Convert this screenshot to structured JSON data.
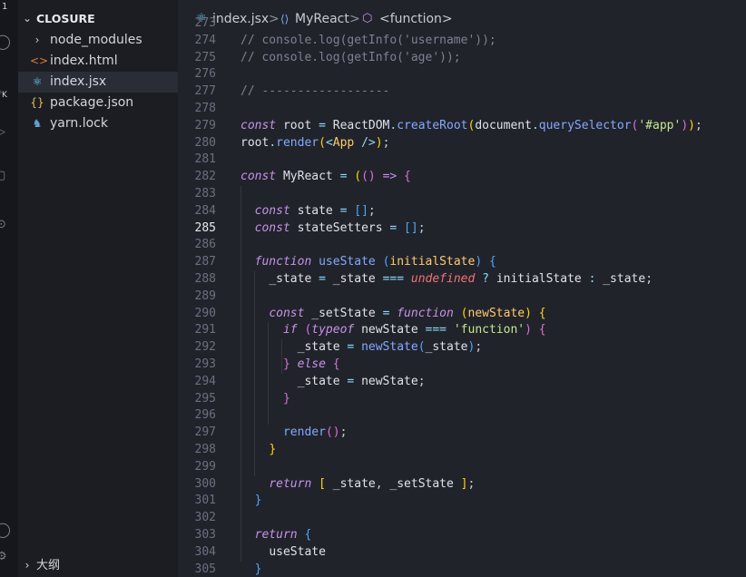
{
  "activity_bar": {
    "top_label": "1",
    "side_label": "K",
    "icons": [
      "account-icon",
      "search-icon",
      "source-control-icon",
      "run-debug-icon",
      "extensions-icon",
      "remote-icon",
      "settings-icon"
    ]
  },
  "explorer": {
    "folder": "CLOSURE",
    "items": [
      {
        "name": "node_modules",
        "icon": "chevron-right-icon",
        "glyph": "›",
        "color": "#c9ccd6"
      },
      {
        "name": "index.html",
        "icon": "html-file-icon",
        "glyph": "<>",
        "color": "#e37933"
      },
      {
        "name": "index.jsx",
        "icon": "react-file-icon",
        "glyph": "⚛",
        "color": "#61dafb"
      },
      {
        "name": "package.json",
        "icon": "json-file-icon",
        "glyph": "{}",
        "color": "#e2c04d"
      },
      {
        "name": "yarn.lock",
        "icon": "yarn-file-icon",
        "glyph": "♞",
        "color": "#5ea8d8"
      }
    ],
    "outline_label": "大纲"
  },
  "breadcrumb": {
    "file": "index.jsx",
    "symbol": "MyReact",
    "function": "<function>",
    "separator": ">"
  },
  "editor": {
    "current_line": 285,
    "lines": [
      {
        "n": 273,
        "t": []
      },
      {
        "n": 274,
        "t": [
          [
            "c-com",
            "// console.log(getInfo('username'));"
          ]
        ]
      },
      {
        "n": 275,
        "t": [
          [
            "c-com",
            "// console.log(getInfo('age'));"
          ]
        ]
      },
      {
        "n": 276,
        "t": []
      },
      {
        "n": 277,
        "t": [
          [
            "c-com",
            "// ------------------"
          ]
        ]
      },
      {
        "n": 278,
        "t": []
      },
      {
        "n": 279,
        "t": [
          [
            "c-kw",
            "const"
          ],
          [
            "c-p",
            " "
          ],
          [
            "c-id",
            "root"
          ],
          [
            "c-p",
            " "
          ],
          [
            "c-op",
            "="
          ],
          [
            "c-p",
            " "
          ],
          [
            "c-id",
            "ReactDOM"
          ],
          [
            "c-op",
            "."
          ],
          [
            "c-fn",
            "createRoot"
          ],
          [
            "c-br",
            "("
          ],
          [
            "c-id",
            "document"
          ],
          [
            "c-op",
            "."
          ],
          [
            "c-fn",
            "querySelector"
          ],
          [
            "c-br2",
            "("
          ],
          [
            "c-str",
            "'#app'"
          ],
          [
            "c-br2",
            ")"
          ],
          [
            "c-br",
            ")"
          ],
          [
            "c-p",
            ";"
          ]
        ]
      },
      {
        "n": 280,
        "t": [
          [
            "c-id",
            "root"
          ],
          [
            "c-op",
            "."
          ],
          [
            "c-fn",
            "render"
          ],
          [
            "c-br",
            "("
          ],
          [
            "c-tag",
            "<"
          ],
          [
            "c-cls",
            "App"
          ],
          [
            "c-p",
            " "
          ],
          [
            "c-tag",
            "/>"
          ],
          [
            "c-br",
            ")"
          ],
          [
            "c-p",
            ";"
          ]
        ]
      },
      {
        "n": 281,
        "t": []
      },
      {
        "n": 282,
        "t": [
          [
            "c-kw",
            "const"
          ],
          [
            "c-p",
            " "
          ],
          [
            "c-id",
            "MyReact"
          ],
          [
            "c-p",
            " "
          ],
          [
            "c-op",
            "="
          ],
          [
            "c-p",
            " "
          ],
          [
            "c-br",
            "("
          ],
          [
            "c-br2",
            "("
          ],
          [
            "c-br2",
            ")"
          ],
          [
            "c-p",
            " "
          ],
          [
            "c-kw",
            "=>"
          ],
          [
            "c-p",
            " "
          ],
          [
            "c-br2",
            "{"
          ]
        ]
      },
      {
        "n": 283,
        "t": []
      },
      {
        "n": 284,
        "t": [
          [
            "c-p",
            "  "
          ],
          [
            "c-kw",
            "const"
          ],
          [
            "c-p",
            " "
          ],
          [
            "c-id",
            "state"
          ],
          [
            "c-p",
            " "
          ],
          [
            "c-op",
            "="
          ],
          [
            "c-p",
            " "
          ],
          [
            "c-br3",
            "[]"
          ],
          [
            "c-p",
            ";"
          ]
        ]
      },
      {
        "n": 285,
        "t": [
          [
            "c-p",
            "  "
          ],
          [
            "c-kw",
            "const"
          ],
          [
            "c-p",
            " "
          ],
          [
            "c-id",
            "stateSetters"
          ],
          [
            "c-p",
            " "
          ],
          [
            "c-op",
            "="
          ],
          [
            "c-p",
            " "
          ],
          [
            "c-br3",
            "[]"
          ],
          [
            "c-p",
            ";"
          ]
        ]
      },
      {
        "n": 286,
        "t": []
      },
      {
        "n": 287,
        "t": [
          [
            "c-p",
            "  "
          ],
          [
            "c-kw",
            "function"
          ],
          [
            "c-p",
            " "
          ],
          [
            "c-fn",
            "useState"
          ],
          [
            "c-p",
            " "
          ],
          [
            "c-br3",
            "("
          ],
          [
            "c-prm",
            "initialState"
          ],
          [
            "c-br3",
            ")"
          ],
          [
            "c-p",
            " "
          ],
          [
            "c-br3",
            "{"
          ]
        ]
      },
      {
        "n": 288,
        "t": [
          [
            "c-p",
            "    "
          ],
          [
            "c-id",
            "_state"
          ],
          [
            "c-p",
            " "
          ],
          [
            "c-op",
            "="
          ],
          [
            "c-p",
            " "
          ],
          [
            "c-id",
            "_state"
          ],
          [
            "c-p",
            " "
          ],
          [
            "c-op",
            "==="
          ],
          [
            "c-p",
            " "
          ],
          [
            "c-und",
            "undefined"
          ],
          [
            "c-p",
            " "
          ],
          [
            "c-op",
            "?"
          ],
          [
            "c-p",
            " "
          ],
          [
            "c-id",
            "initialState"
          ],
          [
            "c-p",
            " "
          ],
          [
            "c-op",
            ":"
          ],
          [
            "c-p",
            " "
          ],
          [
            "c-id",
            "_state"
          ],
          [
            "c-p",
            ";"
          ]
        ]
      },
      {
        "n": 289,
        "t": []
      },
      {
        "n": 290,
        "t": [
          [
            "c-p",
            "    "
          ],
          [
            "c-kw",
            "const"
          ],
          [
            "c-p",
            " "
          ],
          [
            "c-id",
            "_setState"
          ],
          [
            "c-p",
            " "
          ],
          [
            "c-op",
            "="
          ],
          [
            "c-p",
            " "
          ],
          [
            "c-kw",
            "function"
          ],
          [
            "c-p",
            " "
          ],
          [
            "c-br",
            "("
          ],
          [
            "c-prm",
            "newState"
          ],
          [
            "c-br",
            ")"
          ],
          [
            "c-p",
            " "
          ],
          [
            "c-br",
            "{"
          ]
        ]
      },
      {
        "n": 291,
        "t": [
          [
            "c-p",
            "      "
          ],
          [
            "c-kw",
            "if"
          ],
          [
            "c-p",
            " "
          ],
          [
            "c-br2",
            "("
          ],
          [
            "c-kw",
            "typeof"
          ],
          [
            "c-p",
            " "
          ],
          [
            "c-id",
            "newState"
          ],
          [
            "c-p",
            " "
          ],
          [
            "c-op",
            "==="
          ],
          [
            "c-p",
            " "
          ],
          [
            "c-str",
            "'function'"
          ],
          [
            "c-br2",
            ")"
          ],
          [
            "c-p",
            " "
          ],
          [
            "c-br2",
            "{"
          ]
        ]
      },
      {
        "n": 292,
        "t": [
          [
            "c-p",
            "        "
          ],
          [
            "c-id",
            "_state"
          ],
          [
            "c-p",
            " "
          ],
          [
            "c-op",
            "="
          ],
          [
            "c-p",
            " "
          ],
          [
            "c-fn",
            "newState"
          ],
          [
            "c-br3",
            "("
          ],
          [
            "c-id",
            "_state"
          ],
          [
            "c-br3",
            ")"
          ],
          [
            "c-p",
            ";"
          ]
        ]
      },
      {
        "n": 293,
        "t": [
          [
            "c-p",
            "      "
          ],
          [
            "c-br2",
            "}"
          ],
          [
            "c-p",
            " "
          ],
          [
            "c-kw",
            "else"
          ],
          [
            "c-p",
            " "
          ],
          [
            "c-br2",
            "{"
          ]
        ]
      },
      {
        "n": 294,
        "t": [
          [
            "c-p",
            "        "
          ],
          [
            "c-id",
            "_state"
          ],
          [
            "c-p",
            " "
          ],
          [
            "c-op",
            "="
          ],
          [
            "c-p",
            " "
          ],
          [
            "c-id",
            "newState"
          ],
          [
            "c-p",
            ";"
          ]
        ]
      },
      {
        "n": 295,
        "t": [
          [
            "c-p",
            "      "
          ],
          [
            "c-br2",
            "}"
          ]
        ]
      },
      {
        "n": 296,
        "t": []
      },
      {
        "n": 297,
        "t": [
          [
            "c-p",
            "      "
          ],
          [
            "c-fn",
            "render"
          ],
          [
            "c-br2",
            "()"
          ],
          [
            "c-p",
            ";"
          ]
        ]
      },
      {
        "n": 298,
        "t": [
          [
            "c-p",
            "    "
          ],
          [
            "c-br",
            "}"
          ]
        ]
      },
      {
        "n": 299,
        "t": []
      },
      {
        "n": 300,
        "t": [
          [
            "c-p",
            "    "
          ],
          [
            "c-kw",
            "return"
          ],
          [
            "c-p",
            " "
          ],
          [
            "c-br",
            "["
          ],
          [
            "c-p",
            " "
          ],
          [
            "c-id",
            "_state"
          ],
          [
            "c-p",
            ", "
          ],
          [
            "c-id",
            "_setState"
          ],
          [
            "c-p",
            " "
          ],
          [
            "c-br",
            "]"
          ],
          [
            "c-p",
            ";"
          ]
        ]
      },
      {
        "n": 301,
        "t": [
          [
            "c-p",
            "  "
          ],
          [
            "c-br3",
            "}"
          ]
        ]
      },
      {
        "n": 302,
        "t": []
      },
      {
        "n": 303,
        "t": [
          [
            "c-p",
            "  "
          ],
          [
            "c-kw",
            "return"
          ],
          [
            "c-p",
            " "
          ],
          [
            "c-br3",
            "{"
          ]
        ]
      },
      {
        "n": 304,
        "t": [
          [
            "c-p",
            "    "
          ],
          [
            "c-id",
            "useState"
          ]
        ]
      },
      {
        "n": 305,
        "t": [
          [
            "c-p",
            "  "
          ],
          [
            "c-br3",
            "}"
          ]
        ]
      }
    ]
  }
}
